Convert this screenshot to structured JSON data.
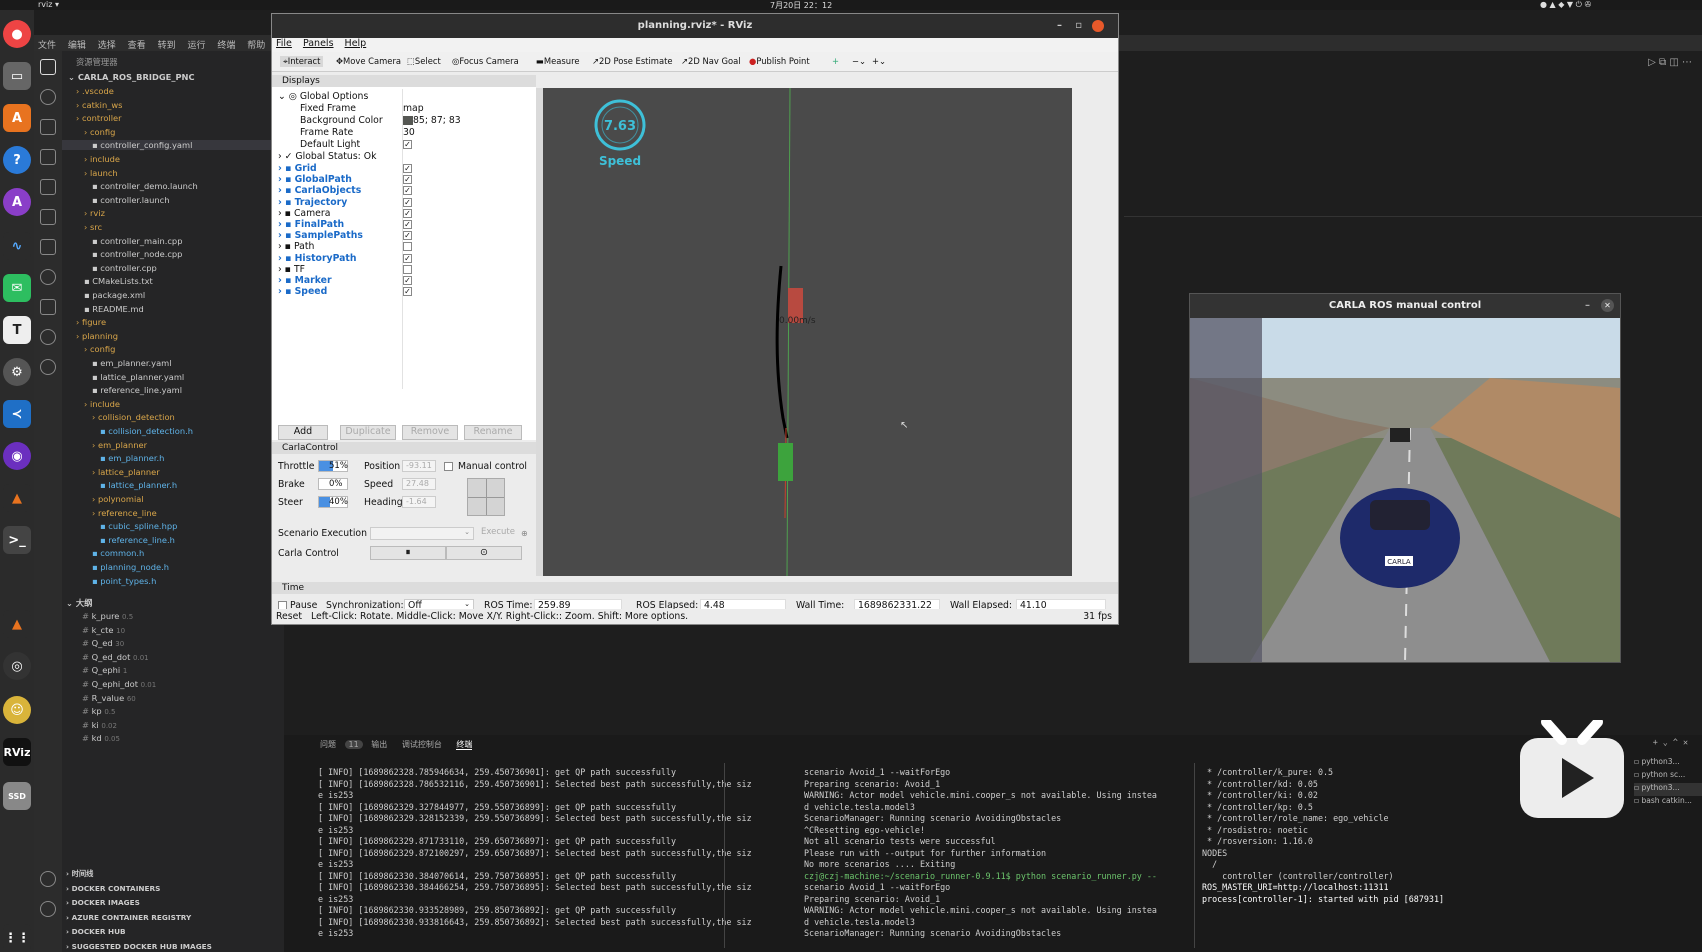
{
  "topbar": {
    "app": "rviz ▾",
    "time": "7月20日 22：12"
  },
  "vsmenu": [
    "文件",
    "编辑",
    "选择",
    "查看",
    "转到",
    "运行",
    "终端",
    "帮助"
  ],
  "explorer": {
    "header": "资源管理器",
    "root": "CARLA_ROS_BRIDGE_PNC",
    "items": [
      ".vscode",
      "catkin_ws",
      "controller",
      "config",
      "controller_config.yaml",
      "include",
      "launch",
      "controller_demo.launch",
      "controller.launch",
      "rviz",
      "src",
      "controller_main.cpp",
      "controller_node.cpp",
      "controller.cpp",
      "CMakeLists.txt",
      "package.xml",
      "README.md",
      "figure",
      "planning",
      "config",
      "em_planner.yaml",
      "lattice_planner.yaml",
      "reference_line.yaml",
      "include",
      "collision_detection",
      "collision_detection.h",
      "em_planner",
      "em_planner.h",
      "lattice_planner",
      "lattice_planner.h",
      "polynomial",
      "reference_line",
      "cubic_spline.hpp",
      "reference_line.h",
      "common.h",
      "planning_node.h",
      "point_types.h"
    ],
    "outline_header": "大纲",
    "outline": [
      [
        "k_pure",
        "0.5"
      ],
      [
        "k_cte",
        "10"
      ],
      [
        "Q_ed",
        "30"
      ],
      [
        "Q_ed_dot",
        "0.01"
      ],
      [
        "Q_ephi",
        "1"
      ],
      [
        "Q_ephi_dot",
        "0.01"
      ],
      [
        "R_value",
        "60"
      ],
      [
        "kp",
        "0.5"
      ],
      [
        "ki",
        "0.02"
      ],
      [
        "kd",
        "0.05"
      ]
    ],
    "bottom": [
      "时间线",
      "DOCKER CONTAINERS",
      "DOCKER IMAGES",
      "AZURE CONTAINER REGISTRY",
      "DOCKER HUB",
      "SUGGESTED DOCKER HUB IMAGES"
    ]
  },
  "rviz": {
    "title": "planning.rviz* - RViz",
    "menu": [
      "File",
      "Panels",
      "Help"
    ],
    "tools": [
      "Interact",
      "Move Camera",
      "Select",
      "Focus Camera",
      "Measure",
      "2D Pose Estimate",
      "2D Nav Goal",
      "Publish Point"
    ],
    "displays_title": "Displays",
    "global_options": "Global Options",
    "fixed_frame_label": "Fixed Frame",
    "fixed_frame": "map",
    "bg_label": "Background Color",
    "bg": "85; 87; 83",
    "rate_label": "Frame Rate",
    "rate": "30",
    "light_label": "Default Light",
    "status": "Global Status: Ok",
    "displays": [
      "Grid",
      "GlobalPath",
      "CarlaObjects",
      "Trajectory",
      "Camera",
      "FinalPath",
      "SamplePaths",
      "Path",
      "HistoryPath",
      "TF",
      "Marker",
      "Speed"
    ],
    "buttons": [
      "Add",
      "Duplicate",
      "Remove",
      "Rename"
    ],
    "carla_title": "CarlaControl",
    "throttle_label": "Throttle",
    "throttle": "51%",
    "brake_label": "Brake",
    "brake": "0%",
    "steer_label": "Steer",
    "steer": "40%",
    "position_label": "Position",
    "position": "-93.11",
    "speed_label": "Speed",
    "speed": "27.48",
    "heading_label": "Heading",
    "heading": "-1.64",
    "manual": "Manual control",
    "scenario_label": "Scenario Execution",
    "execute": "Execute",
    "carla_control": "Carla Control",
    "time_title": "Time",
    "pause": "Pause",
    "sync_label": "Synchronization:",
    "sync": "Off",
    "ros_time_label": "ROS Time:",
    "ros_time": "259.89",
    "ros_elapsed_label": "ROS Elapsed:",
    "ros_elapsed": "4.48",
    "wall_time_label": "Wall Time:",
    "wall_time": "1689862331.22",
    "wall_elapsed_label": "Wall Elapsed:",
    "wall_elapsed": "41.10",
    "reset": "Reset",
    "help": "Left-Click: Rotate. Middle-Click: Move X/Y. Right-Click:: Zoom. Shift: More options.",
    "fps": "31 fps",
    "speed_gauge": "7.63",
    "speed_word": "Speed",
    "car_label": "0.00m/s"
  },
  "carla": {
    "title": "CARLA ROS manual control",
    "plate": "CARLA"
  },
  "terminal": {
    "tabs": [
      "问题",
      "11",
      "输出",
      "调试控制台",
      "终端"
    ],
    "left": [
      "[ INFO] [1689862328.785946634, 259.450736901]: get QP path successfully",
      "[ INFO] [1689862328.786532116, 259.450736901]: Selected best path successfully,the siz",
      "e is253",
      "[ INFO] [1689862329.327844977, 259.550736899]: get QP path successfully",
      "[ INFO] [1689862329.328152339, 259.550736899]: Selected best path successfully,the siz",
      "e is253",
      "[ INFO] [1689862329.871733110, 259.650736897]: get QP path successfully",
      "[ INFO] [1689862329.872100297, 259.650736897]: Selected best path successfully,the siz",
      "e is253",
      "[ INFO] [1689862330.384070614, 259.750736895]: get QP path successfully",
      "[ INFO] [1689862330.384466254, 259.750736895]: Selected best path successfully,the siz",
      "e is253",
      "[ INFO] [1689862330.933528989, 259.850736892]: get QP path successfully",
      "[ INFO] [1689862330.933816643, 259.850736892]: Selected best path successfully,the siz",
      "e is253"
    ],
    "mid": [
      "scenario Avoid_1 --waitForEgo",
      "Preparing scenario: Avoid_1",
      "WARNING: Actor model vehicle.mini.cooper_s not available. Using instea",
      "d vehicle.tesla.model3",
      "ScenarioManager: Running scenario AvoidingObstacles",
      "^CResetting ego-vehicle!",
      "Not all scenario tests were successful",
      "Please run with --output for further information",
      "No more scenarios .... Exiting",
      "czj@czj-machine:~/scenario_runner-0.9.11$ python scenario_runner.py --",
      "scenario Avoid_1 --waitForEgo",
      "Preparing scenario: Avoid_1",
      "WARNING: Actor model vehicle.mini.cooper_s not available. Using instea",
      "d vehicle.tesla.model3",
      "ScenarioManager: Running scenario AvoidingObstacles"
    ],
    "right": [
      " * /controller/k_pure: 0.5",
      " * /controller/kd: 0.05",
      " * /controller/ki: 0.02",
      " * /controller/kp: 0.5",
      " * /controller/role_name: ego_vehicle",
      " * /rosdistro: noetic",
      " * /rosversion: 1.16.0",
      "",
      "NODES",
      "  /",
      "    controller (controller/controller)",
      "",
      "ROS_MASTER_URI=http://localhost:11311",
      "",
      "process[controller-1]: started with pid [687931]"
    ],
    "sessions": [
      "python3...",
      "python sc...",
      "python3...",
      "bash catkin..."
    ]
  }
}
